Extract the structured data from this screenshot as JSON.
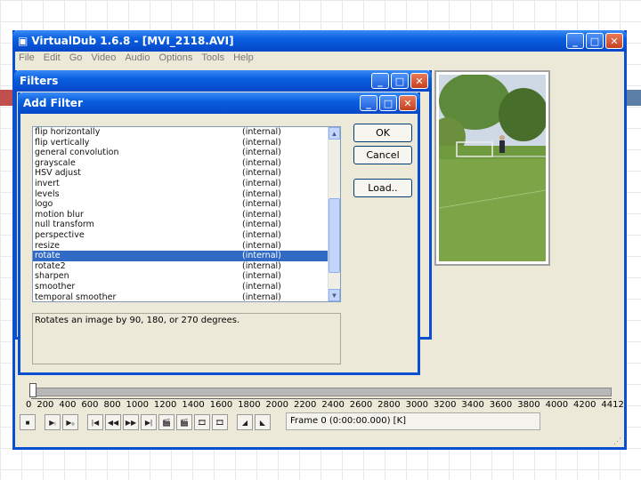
{
  "main_window": {
    "title": "VirtualDub 1.6.8 - [MVI_2118.AVI]",
    "menu": [
      "File",
      "Edit",
      "Go",
      "Video",
      "Audio",
      "Options",
      "Tools",
      "Help"
    ]
  },
  "filters_window": {
    "title": "Filters"
  },
  "add_filter": {
    "title": "Add Filter",
    "filters": [
      {
        "name": "flip horizontally",
        "type": "(internal)"
      },
      {
        "name": "flip vertically",
        "type": "(internal)"
      },
      {
        "name": "general convolution",
        "type": "(internal)"
      },
      {
        "name": "grayscale",
        "type": "(internal)"
      },
      {
        "name": "HSV adjust",
        "type": "(internal)"
      },
      {
        "name": "invert",
        "type": "(internal)"
      },
      {
        "name": "levels",
        "type": "(internal)"
      },
      {
        "name": "logo",
        "type": "(internal)"
      },
      {
        "name": "motion blur",
        "type": "(internal)"
      },
      {
        "name": "null transform",
        "type": "(internal)"
      },
      {
        "name": "perspective",
        "type": "(internal)"
      },
      {
        "name": "resize",
        "type": "(internal)"
      },
      {
        "name": "rotate",
        "type": "(internal)"
      },
      {
        "name": "rotate2",
        "type": "(internal)"
      },
      {
        "name": "sharpen",
        "type": "(internal)"
      },
      {
        "name": "smoother",
        "type": "(internal)"
      },
      {
        "name": "temporal smoother",
        "type": "(internal)"
      }
    ],
    "selected_filter": "rotate",
    "ok_label": "OK",
    "cancel_label": "Cancel",
    "load_label": "Load..",
    "description": "Rotates an image by 90, 180, or 270 degrees."
  },
  "timeline": {
    "ticks": [
      "0",
      "200",
      "400",
      "600",
      "800",
      "1000",
      "1200",
      "1400",
      "1600",
      "1800",
      "2000",
      "2200",
      "2400",
      "2600",
      "2800",
      "3000",
      "3200",
      "3400",
      "3600",
      "3800",
      "4000",
      "4200",
      "4412"
    ],
    "frame_text": "Frame 0 (0:00:00.000) [K]"
  },
  "colors": {
    "titlebar": "#0a5fe0",
    "selection": "#316ac5",
    "window_bg": "#ece9d8",
    "accent_bar": "#5b7fa6",
    "accent_red": "#c0504d"
  }
}
